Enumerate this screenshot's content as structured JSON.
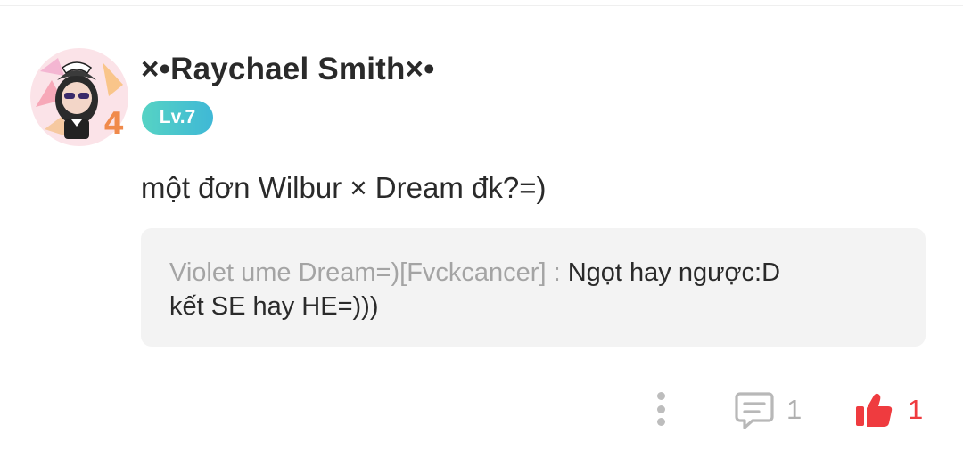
{
  "comment": {
    "author": {
      "name": "×•Raychael Smith×•",
      "level": "Lv.7"
    },
    "text": "một đơn Wilbur × Dream đk?=)",
    "quote": {
      "author": "Violet ume Dream=)[Fvckcancer] :",
      "text_line1": "Ngọt hay ngược:D",
      "text_line2": "kết SE hay HE=)))"
    },
    "actions": {
      "reply_count": "1",
      "like_count": "1"
    }
  },
  "colors": {
    "level_badge_start": "#56d3c4",
    "level_badge_end": "#3fb8d6",
    "like_accent": "#ef3b3f",
    "muted_text": "#a4a4a4",
    "quote_background": "#f3f3f3"
  },
  "icons": {
    "more": "more-vertical-icon",
    "reply": "comment-bubble-icon",
    "like": "thumbs-up-icon"
  }
}
